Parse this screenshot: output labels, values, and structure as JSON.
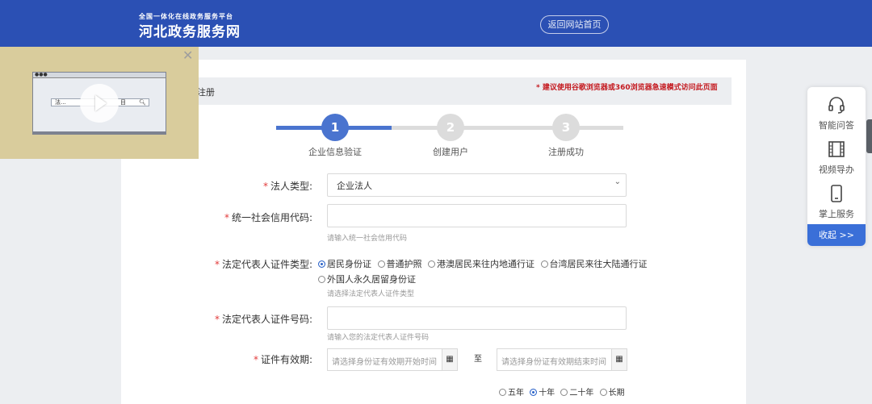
{
  "header": {
    "logo_small": "全国一体化在线政务服务平台",
    "logo_big": "河北政务服务网",
    "home_button": "返回网站首页"
  },
  "registration": {
    "title": "注册",
    "browser_hint": "* 建议使用谷歌浏览器或360浏览器急速模式访问此页面"
  },
  "steps": [
    {
      "number": "1",
      "label": "企业信息验证",
      "active": true
    },
    {
      "number": "2",
      "label": "创建用户",
      "active": false
    },
    {
      "number": "3",
      "label": "注册成功",
      "active": false
    }
  ],
  "form": {
    "required_mark": "*",
    "legal_type": {
      "label": "法人类型:",
      "value": "企业法人"
    },
    "credit_code": {
      "label": "统一社会信用代码:",
      "value": "",
      "help": "请输入统一社会信用代码"
    },
    "cert_type": {
      "label": "法定代表人证件类型:",
      "options": [
        "居民身份证",
        "普通护照",
        "港澳居民来往内地通行证",
        "台湾居民来往大陆通行证",
        "外国人永久居留身份证"
      ],
      "selected": "居民身份证",
      "help": "请选择法定代表人证件类型"
    },
    "cert_number": {
      "label": "法定代表人证件号码:",
      "value": "",
      "help": "请输入您的法定代表人证件号码"
    },
    "validity": {
      "label": "证件有效期:",
      "start_placeholder": "请选择身份证有效期开始时间",
      "end_placeholder": "请选择身份证有效期结束时间",
      "separator": "至",
      "period_options": [
        "五年",
        "十年",
        "二十年",
        "长期"
      ],
      "period_selected": "十年"
    }
  },
  "side_panel": {
    "items": [
      {
        "label": "智能问答",
        "icon": "headset-icon"
      },
      {
        "label": "视频导办",
        "icon": "film-icon"
      },
      {
        "label": "掌上服务",
        "icon": "mobile-icon"
      }
    ],
    "collapse_label": "收起 >>"
  },
  "video": {
    "thumb_search_text": "法...",
    "thumb_search_right": "目"
  },
  "colors": {
    "header_bg": "#2b50b4",
    "accent": "#4a74cf",
    "required": "#e23b3b",
    "hint_red": "#c4191f",
    "video_panel": "#d9cc9c"
  }
}
